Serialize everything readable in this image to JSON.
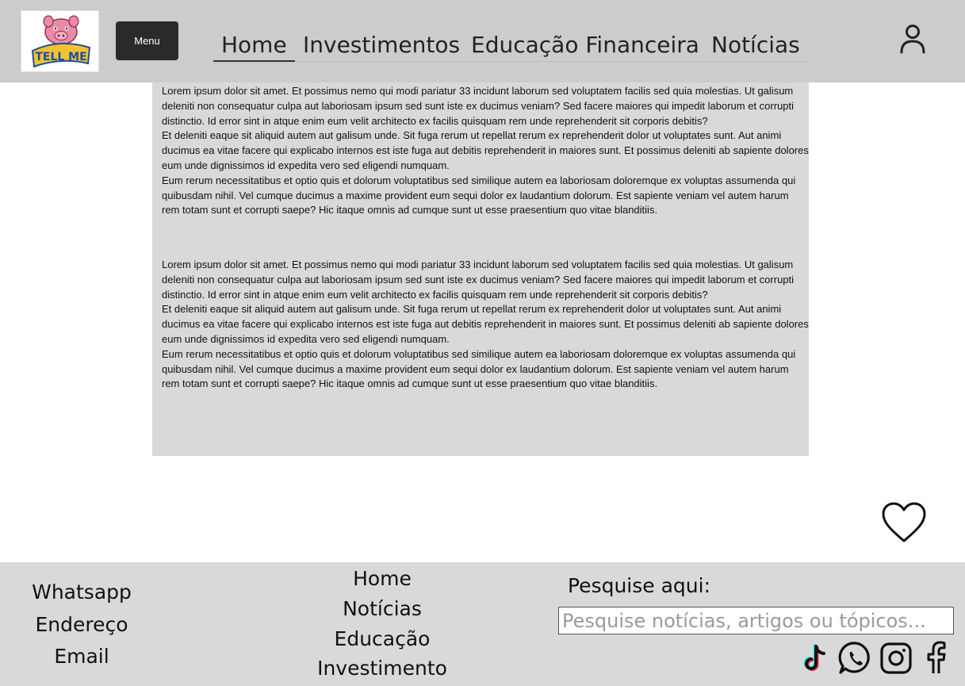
{
  "header": {
    "logo_text": "TELL ME",
    "menu_label": "Menu",
    "nav": [
      "Home",
      "Investimentos",
      "Educação Financeira",
      "Notícias"
    ],
    "active_nav": "Home"
  },
  "article": {
    "blocks": [
      [
        "Lorem ipsum dolor sit amet. Et possimus nemo qui modi pariatur 33 incidunt laborum sed voluptatem facilis sed quia molestias. Ut galisum deleniti non consequatur culpa aut laboriosam ipsum sed sunt iste ex ducimus veniam? Sed facere maiores qui impedit laborum et corrupti distinctio. Id error sint in atque enim eum velit architecto ex facilis quisquam rem unde reprehenderit sit corporis debitis?",
        "Et deleniti eaque sit aliquid autem aut galisum unde. Sit fuga rerum ut repellat rerum ex reprehenderit dolor ut voluptates sunt. Aut animi ducimus ea vitae facere qui explicabo internos est iste fuga aut debitis reprehenderit in maiores sunt. Et possimus deleniti ab sapiente dolores eum unde dignissimos id expedita vero sed eligendi numquam.",
        "Eum rerum necessitatibus et optio quis et dolorum voluptatibus sed similique autem ea laboriosam doloremque ex voluptas assumenda qui quibusdam nihil. Vel cumque ducimus a maxime provident eum sequi dolor ex laudantium dolorum. Est sapiente veniam vel autem harum rem totam sunt et corrupti saepe? Hic itaque omnis ad cumque sunt ut esse praesentium quo vitae blanditiis."
      ],
      [
        "Lorem ipsum dolor sit amet. Et possimus nemo qui modi pariatur 33 incidunt laborum sed voluptatem facilis sed quia molestias. Ut galisum deleniti non consequatur culpa aut laboriosam ipsum sed sunt iste ex ducimus veniam? Sed facere maiores qui impedit laborum et corrupti distinctio. Id error sint in atque enim eum velit architecto ex facilis quisquam rem unde reprehenderit sit corporis debitis?",
        "Et deleniti eaque sit aliquid autem aut galisum unde. Sit fuga rerum ut repellat rerum ex reprehenderit dolor ut voluptates sunt. Aut animi ducimus ea vitae facere qui explicabo internos est iste fuga aut debitis reprehenderit in maiores sunt. Et possimus deleniti ab sapiente dolores eum unde dignissimos id expedita vero sed eligendi numquam.",
        "Eum rerum necessitatibus et optio quis et dolorum voluptatibus sed similique autem ea laboriosam doloremque ex voluptas assumenda qui quibusdam nihil. Vel cumque ducimus a maxime provident eum sequi dolor ex laudantium dolorum. Est sapiente veniam vel autem harum rem totam sunt et corrupti saepe? Hic itaque omnis ad cumque sunt ut esse praesentium quo vitae blanditiis."
      ]
    ]
  },
  "footer": {
    "contacts": [
      "Whatsapp",
      "Endereço",
      "Email"
    ],
    "nav": [
      "Home",
      "Notícias",
      "Educação",
      "Investimento"
    ],
    "search_label": "Pesquise aqui:",
    "search_placeholder": "Pesquise notícias, artigos ou tópicos...",
    "search_value": "",
    "social_icons": [
      "tiktok-icon",
      "whatsapp-icon",
      "instagram-icon",
      "facebook-icon"
    ]
  },
  "icons": {
    "user": "user-icon",
    "favorite": "heart-icon"
  },
  "colors": {
    "header_bg": "#cccccc",
    "article_bg": "#d9d9d9",
    "footer_bg": "#d9d9d9",
    "menu_button_bg": "#2a2a2a"
  }
}
